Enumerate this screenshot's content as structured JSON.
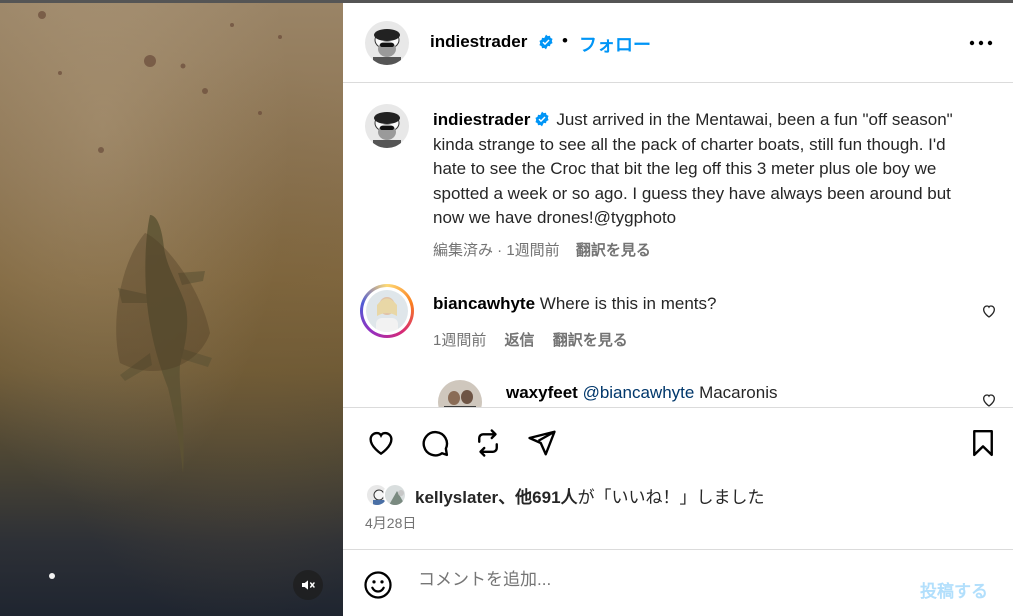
{
  "header": {
    "username": "indiestrader",
    "separator": "•",
    "follow_label": "フォロー"
  },
  "caption": {
    "username": "indiestrader",
    "text": "Just arrived in the Mentawai, been a fun \"off season\" kinda strange to see all the pack of charter boats, still fun though. I'd hate to see the Croc that bit the leg off this 3 meter plus ole boy we spotted a week or so ago. I guess they have always been around but now we have drones!@tygphoto",
    "meta": "編集済み · 1週間前",
    "see_translation": "翻訳を見る"
  },
  "comments": [
    {
      "username": "biancawhyte",
      "text": "Where is this in ments?",
      "time": "1週間前",
      "reply_label": "返信",
      "see_translation": "翻訳を見る"
    },
    {
      "username": "waxyfeet",
      "mention": "@biancawhyte",
      "text": "Macaronis"
    }
  ],
  "likes": {
    "user": "kellyslater",
    "rest": "、他691人",
    "suffix": "が「いいね！」しました"
  },
  "date": "4月28日",
  "composer": {
    "placeholder": "コメントを追加...",
    "post_label": "投稿する"
  },
  "colors": {
    "accent": "#0095f6",
    "verified": "#0095f6",
    "post_disabled": "#b2dffc"
  }
}
